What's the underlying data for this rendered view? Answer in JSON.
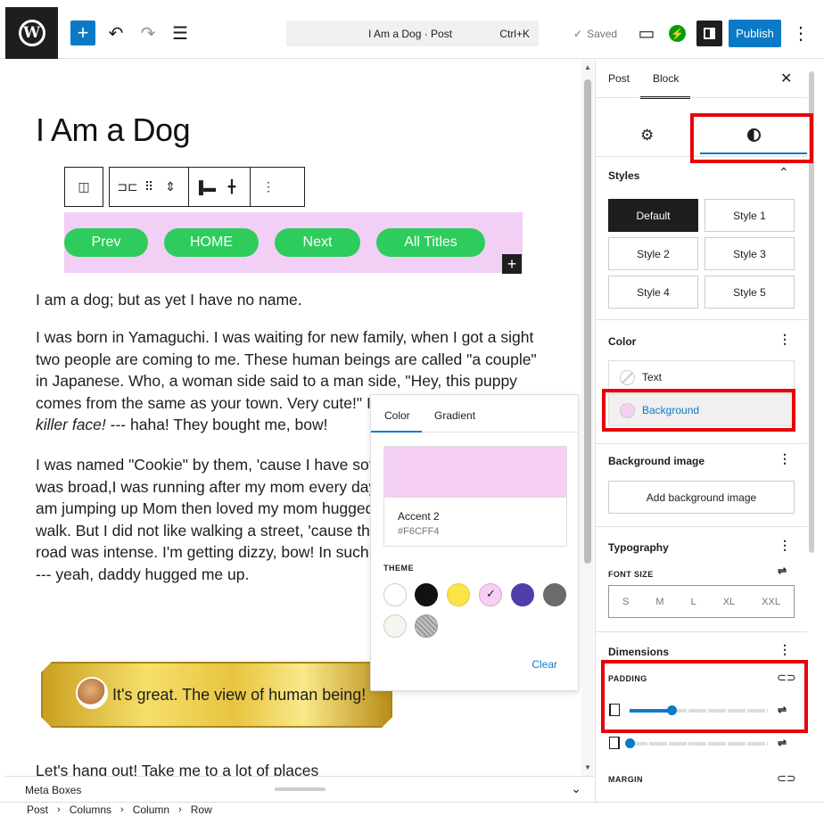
{
  "toolbar": {
    "command_title": "I Am a Dog · Post",
    "command_shortcut": "Ctrl+K",
    "saved_label": "Saved",
    "publish_label": "Publish"
  },
  "post": {
    "title": "I Am a Dog",
    "nav_buttons": [
      "Prev",
      "HOME",
      "Next",
      "All Titles"
    ],
    "nav_bg_color": "#F6CFF4",
    "nav_pill_color": "#2ECC5C",
    "paragraph1": "I am a dog; but as yet I have no name.",
    "paragraph2_lines": [
      "I was born in Yamaguchi. I was waiting for new family, when I got a sight",
      "two people are coming to me. These human beings are called \"a couple\"",
      "in Japanese. Who, a woman side said to a man side, \"Hey, this puppy",
      "comes from the same as your town. Very cute!\" I",
      "--- haha! They bought me, bow!"
    ],
    "paragraph2_italic": "killer face!",
    "paragraph3_lines": [
      "I was named \"Cookie\" by them, 'cause I have soft",
      "was broad,I was running after my mom every day",
      "am jumping up Mom then loved my mom hugged",
      "walk. But I did not like walking a street, 'cause the",
      "road was intense. I'm getting dizzy, bow! In such",
      "--- yeah, daddy hugged me up."
    ],
    "banner_text": "It's great. The view of human being!",
    "last_line": "Let's hang out! Take me to a lot of places"
  },
  "color_popover": {
    "tabs": [
      "Color",
      "Gradient"
    ],
    "selected_name": "Accent 2",
    "selected_hex": "#F6CFF4",
    "theme_label": "THEME",
    "theme_colors": [
      "#FFFFFF",
      "#111111",
      "#FBE44A",
      "#F6CFF4",
      "#4E3DAA",
      "#6B6B6B",
      "#F7F6EE",
      "#A8A8A8"
    ],
    "selected_index": 3,
    "clear_label": "Clear"
  },
  "sidebar": {
    "tabs": [
      "Post",
      "Block"
    ],
    "styles_heading": "Styles",
    "styles": [
      "Default",
      "Style 1",
      "Style 2",
      "Style 3",
      "Style 4",
      "Style 5"
    ],
    "color_heading": "Color",
    "color_items": [
      "Text",
      "Background"
    ],
    "bg_image_heading": "Background image",
    "add_bg_label": "Add background image",
    "typography_heading": "Typography",
    "font_size_label": "FONT SIZE",
    "font_sizes": [
      "S",
      "M",
      "L",
      "XL",
      "XXL"
    ],
    "dimensions_heading": "Dimensions",
    "padding_label": "PADDING",
    "margin_label": "MARGIN",
    "padding_vertical_level": 0.3,
    "padding_horizontal_level": 0.0
  },
  "meta": {
    "label": "Meta Boxes"
  },
  "breadcrumb": [
    "Post",
    "Columns",
    "Column",
    "Row"
  ],
  "colors": {
    "accent": "#0A7AC6",
    "highlight": "#E8000B"
  }
}
